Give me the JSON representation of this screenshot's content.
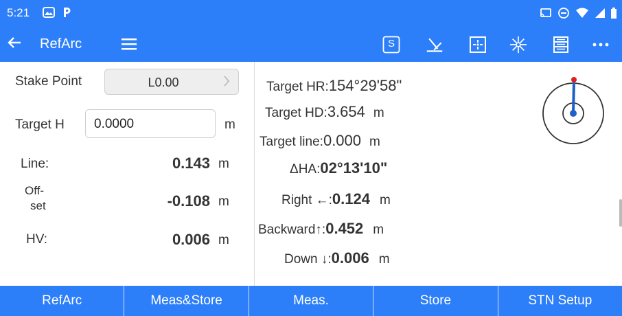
{
  "status_bar": {
    "time": "5:21",
    "icons_left": [
      "gallery-icon",
      "parking-icon"
    ],
    "icons_right": [
      "cast-icon",
      "dnd-icon",
      "wifi-icon",
      "signal-icon",
      "battery-icon"
    ]
  },
  "toolbar": {
    "title": "RefArc",
    "s_label": "S",
    "icons": [
      "back-arrow-icon",
      "hamburger-menu-icon",
      "s-box-icon",
      "laser-icon",
      "target-square-icon",
      "crosshair-star-icon",
      "database-icon",
      "more-icon"
    ]
  },
  "left_panel": {
    "stake_point_label": "Stake Point",
    "stake_point_value": "L0.00",
    "target_h_label": "Target H",
    "target_h_value": "0.0000",
    "target_h_unit": "m",
    "line_label": "Line:",
    "line_value": "0.143",
    "line_unit": "m",
    "offset_label_1": "Off-",
    "offset_label_2": "set",
    "offset_value": "-0.108",
    "offset_unit": "m",
    "hv_label": "HV:",
    "hv_value": "0.006",
    "hv_unit": "m"
  },
  "right_panel": {
    "target_hr_label": "Target HR:",
    "target_hr_value": "154°29'58\"",
    "target_hd_label": "Target HD:",
    "target_hd_value": "3.654",
    "target_hd_unit": "m",
    "target_line_label": "Target line:",
    "target_line_value": "0.000",
    "target_line_unit": "m",
    "dha_label": "ΔHA:",
    "dha_value": "02°13'10\"",
    "right_label": "Right ←:",
    "right_value": "0.124",
    "right_unit": "m",
    "backward_label": "Backward↑:",
    "backward_value": "0.452",
    "backward_unit": "m",
    "down_label": "Down ↓:",
    "down_value": "0.006",
    "down_unit": "m"
  },
  "compass": {
    "ring_color": "#333333",
    "needle_color": "#1e5fc8",
    "tip_color": "#e02020"
  },
  "bottom_nav": {
    "buttons": [
      "RefArc",
      "Meas&Store",
      "Meas.",
      "Store",
      "STN Setup"
    ]
  },
  "colors": {
    "primary": "#2d7ff9"
  }
}
